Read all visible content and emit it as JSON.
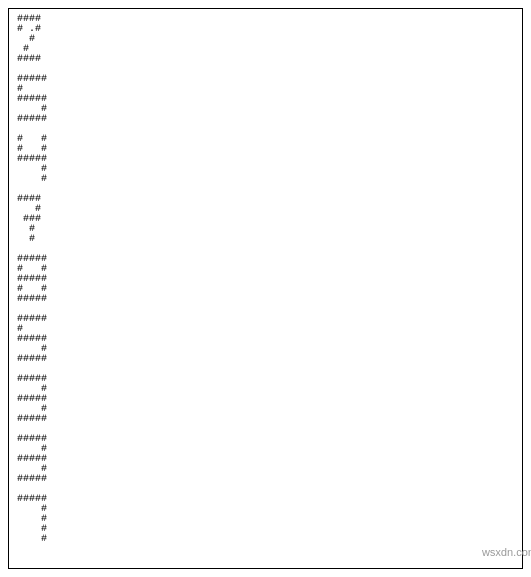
{
  "ascii": {
    "digits": [
      "####\n# .#\n  #\n #\n####",
      "#####\n#\n#####\n    #\n#####",
      "#   #\n#   #\n#####\n    #\n    #",
      "####\n   #\n ###\n  #\n  #",
      "#####\n#   #\n#####\n#   #\n#####",
      "#####\n#\n#####\n    #\n#####",
      "#####\n    #\n#####\n    #\n#####",
      "#####\n    #\n#####\n    #\n#####",
      "#####\n    #\n    #\n    #\n    #"
    ]
  },
  "watermark": "wsxdn.com"
}
